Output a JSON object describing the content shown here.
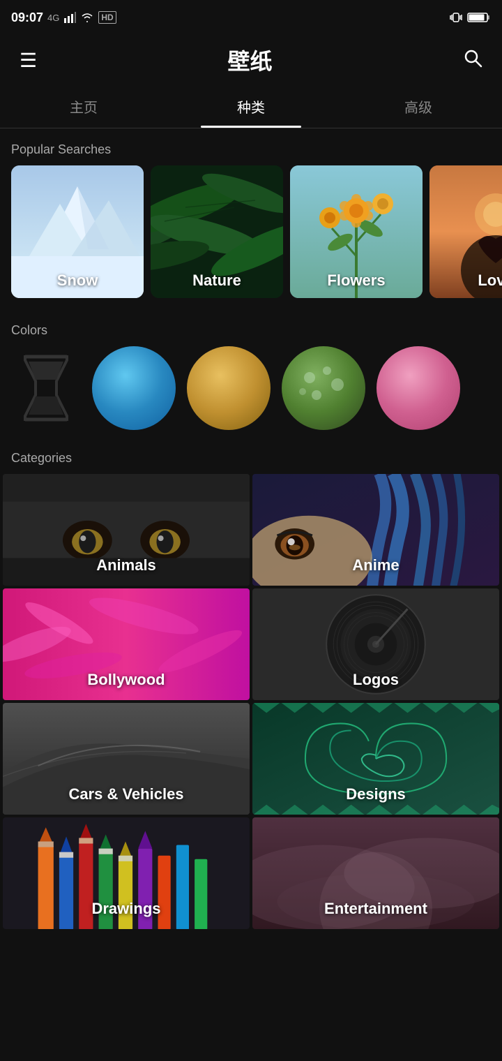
{
  "statusBar": {
    "time": "09:07",
    "signal": "4G",
    "wifi": true,
    "hd": true
  },
  "appBar": {
    "title": "壁纸",
    "menuIcon": "☰",
    "searchIcon": "🔍"
  },
  "tabs": [
    {
      "id": "home",
      "label": "主页",
      "active": false
    },
    {
      "id": "categories",
      "label": "种类",
      "active": true
    },
    {
      "id": "advanced",
      "label": "高级",
      "active": false
    }
  ],
  "popularSearches": {
    "sectionLabel": "Popular Searches",
    "items": [
      {
        "id": "snow",
        "label": "Snow"
      },
      {
        "id": "nature",
        "label": "Nature"
      },
      {
        "id": "flowers",
        "label": "Flowers"
      },
      {
        "id": "love",
        "label": "Love"
      }
    ]
  },
  "colors": {
    "sectionLabel": "Colors",
    "items": [
      {
        "id": "hourglass",
        "type": "hourglass"
      },
      {
        "id": "blue",
        "color": "#3aaae0"
      },
      {
        "id": "gold",
        "color": "#c8a030"
      },
      {
        "id": "green",
        "color": "#5a9040"
      },
      {
        "id": "pink",
        "color": "#e880a0"
      }
    ]
  },
  "categories": {
    "sectionLabel": "Categories",
    "items": [
      {
        "id": "animals",
        "label": "Animals",
        "colorA": "#222",
        "colorB": "#444"
      },
      {
        "id": "anime",
        "label": "Anime",
        "colorA": "#1a1a3a",
        "colorB": "#2a2050"
      },
      {
        "id": "bollywood",
        "label": "Bollywood",
        "colorA": "#d02080",
        "colorB": "#e840a0"
      },
      {
        "id": "logos",
        "label": "Logos",
        "colorA": "#303030",
        "colorB": "#484848"
      },
      {
        "id": "cars",
        "label": "Cars & Vehicles",
        "colorA": "#383838",
        "colorB": "#585858"
      },
      {
        "id": "designs",
        "label": "Designs",
        "colorA": "#0a3a30",
        "colorB": "#1a5040"
      },
      {
        "id": "drawings",
        "label": "Drawings",
        "colorA": "#1a1a2a",
        "colorB": "#2a2a3a"
      },
      {
        "id": "entertainment",
        "label": "Entertainment",
        "colorA": "#4a3040",
        "colorB": "#6a4060"
      }
    ]
  }
}
